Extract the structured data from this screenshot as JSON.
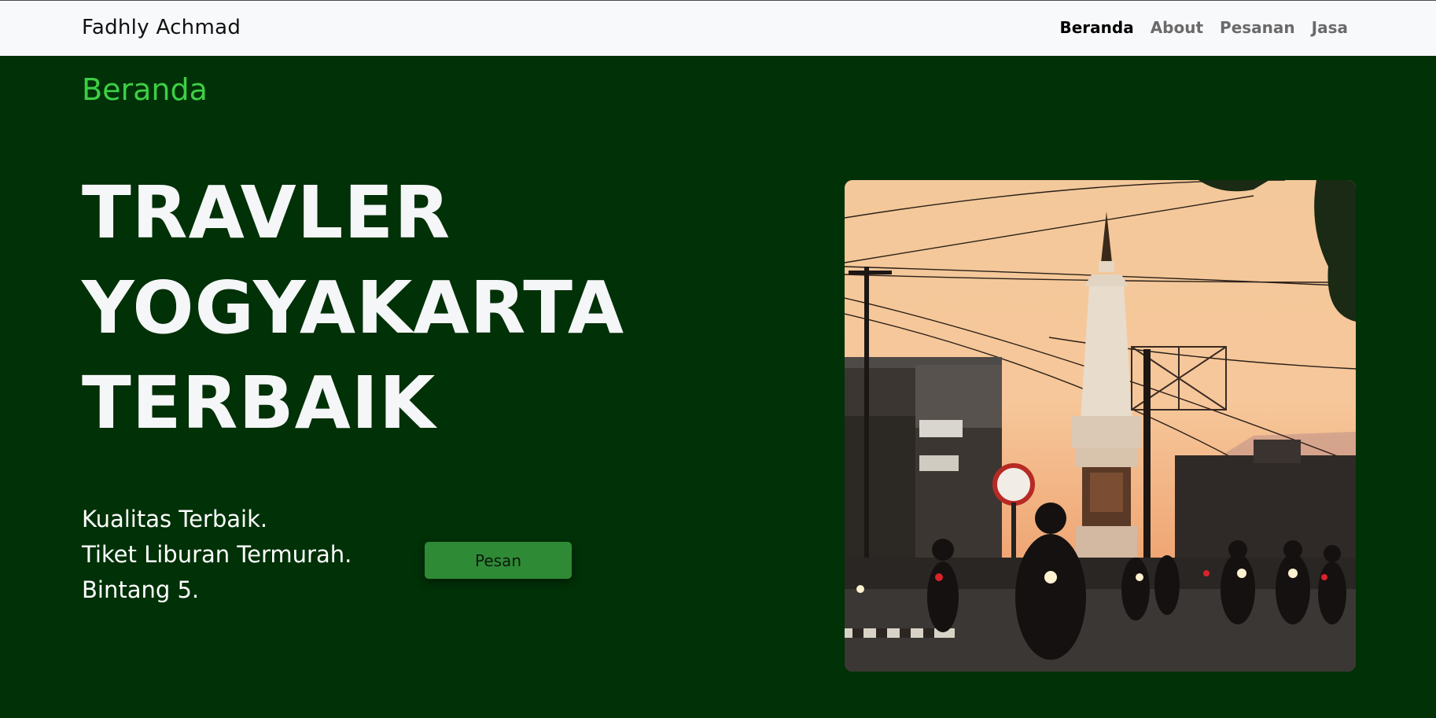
{
  "navbar": {
    "brand": "Fadhly Achmad",
    "links": [
      {
        "label": "Beranda"
      },
      {
        "label": "About"
      },
      {
        "label": "Pesanan"
      },
      {
        "label": "Jasa"
      }
    ]
  },
  "hero": {
    "section_title": "Beranda",
    "headline": [
      "TRAVLER",
      "YOGYAKARTA",
      "TERBAIK"
    ],
    "features": [
      "Kualitas Terbaik.",
      "Tiket Liburan Termurah.",
      "Bintang 5."
    ],
    "order_button_label": "Pesan"
  },
  "colors": {
    "background": "#003107",
    "accent_green": "#3dcf45",
    "button_green": "#2f8a36",
    "navbar_bg": "#f8f9fb"
  }
}
